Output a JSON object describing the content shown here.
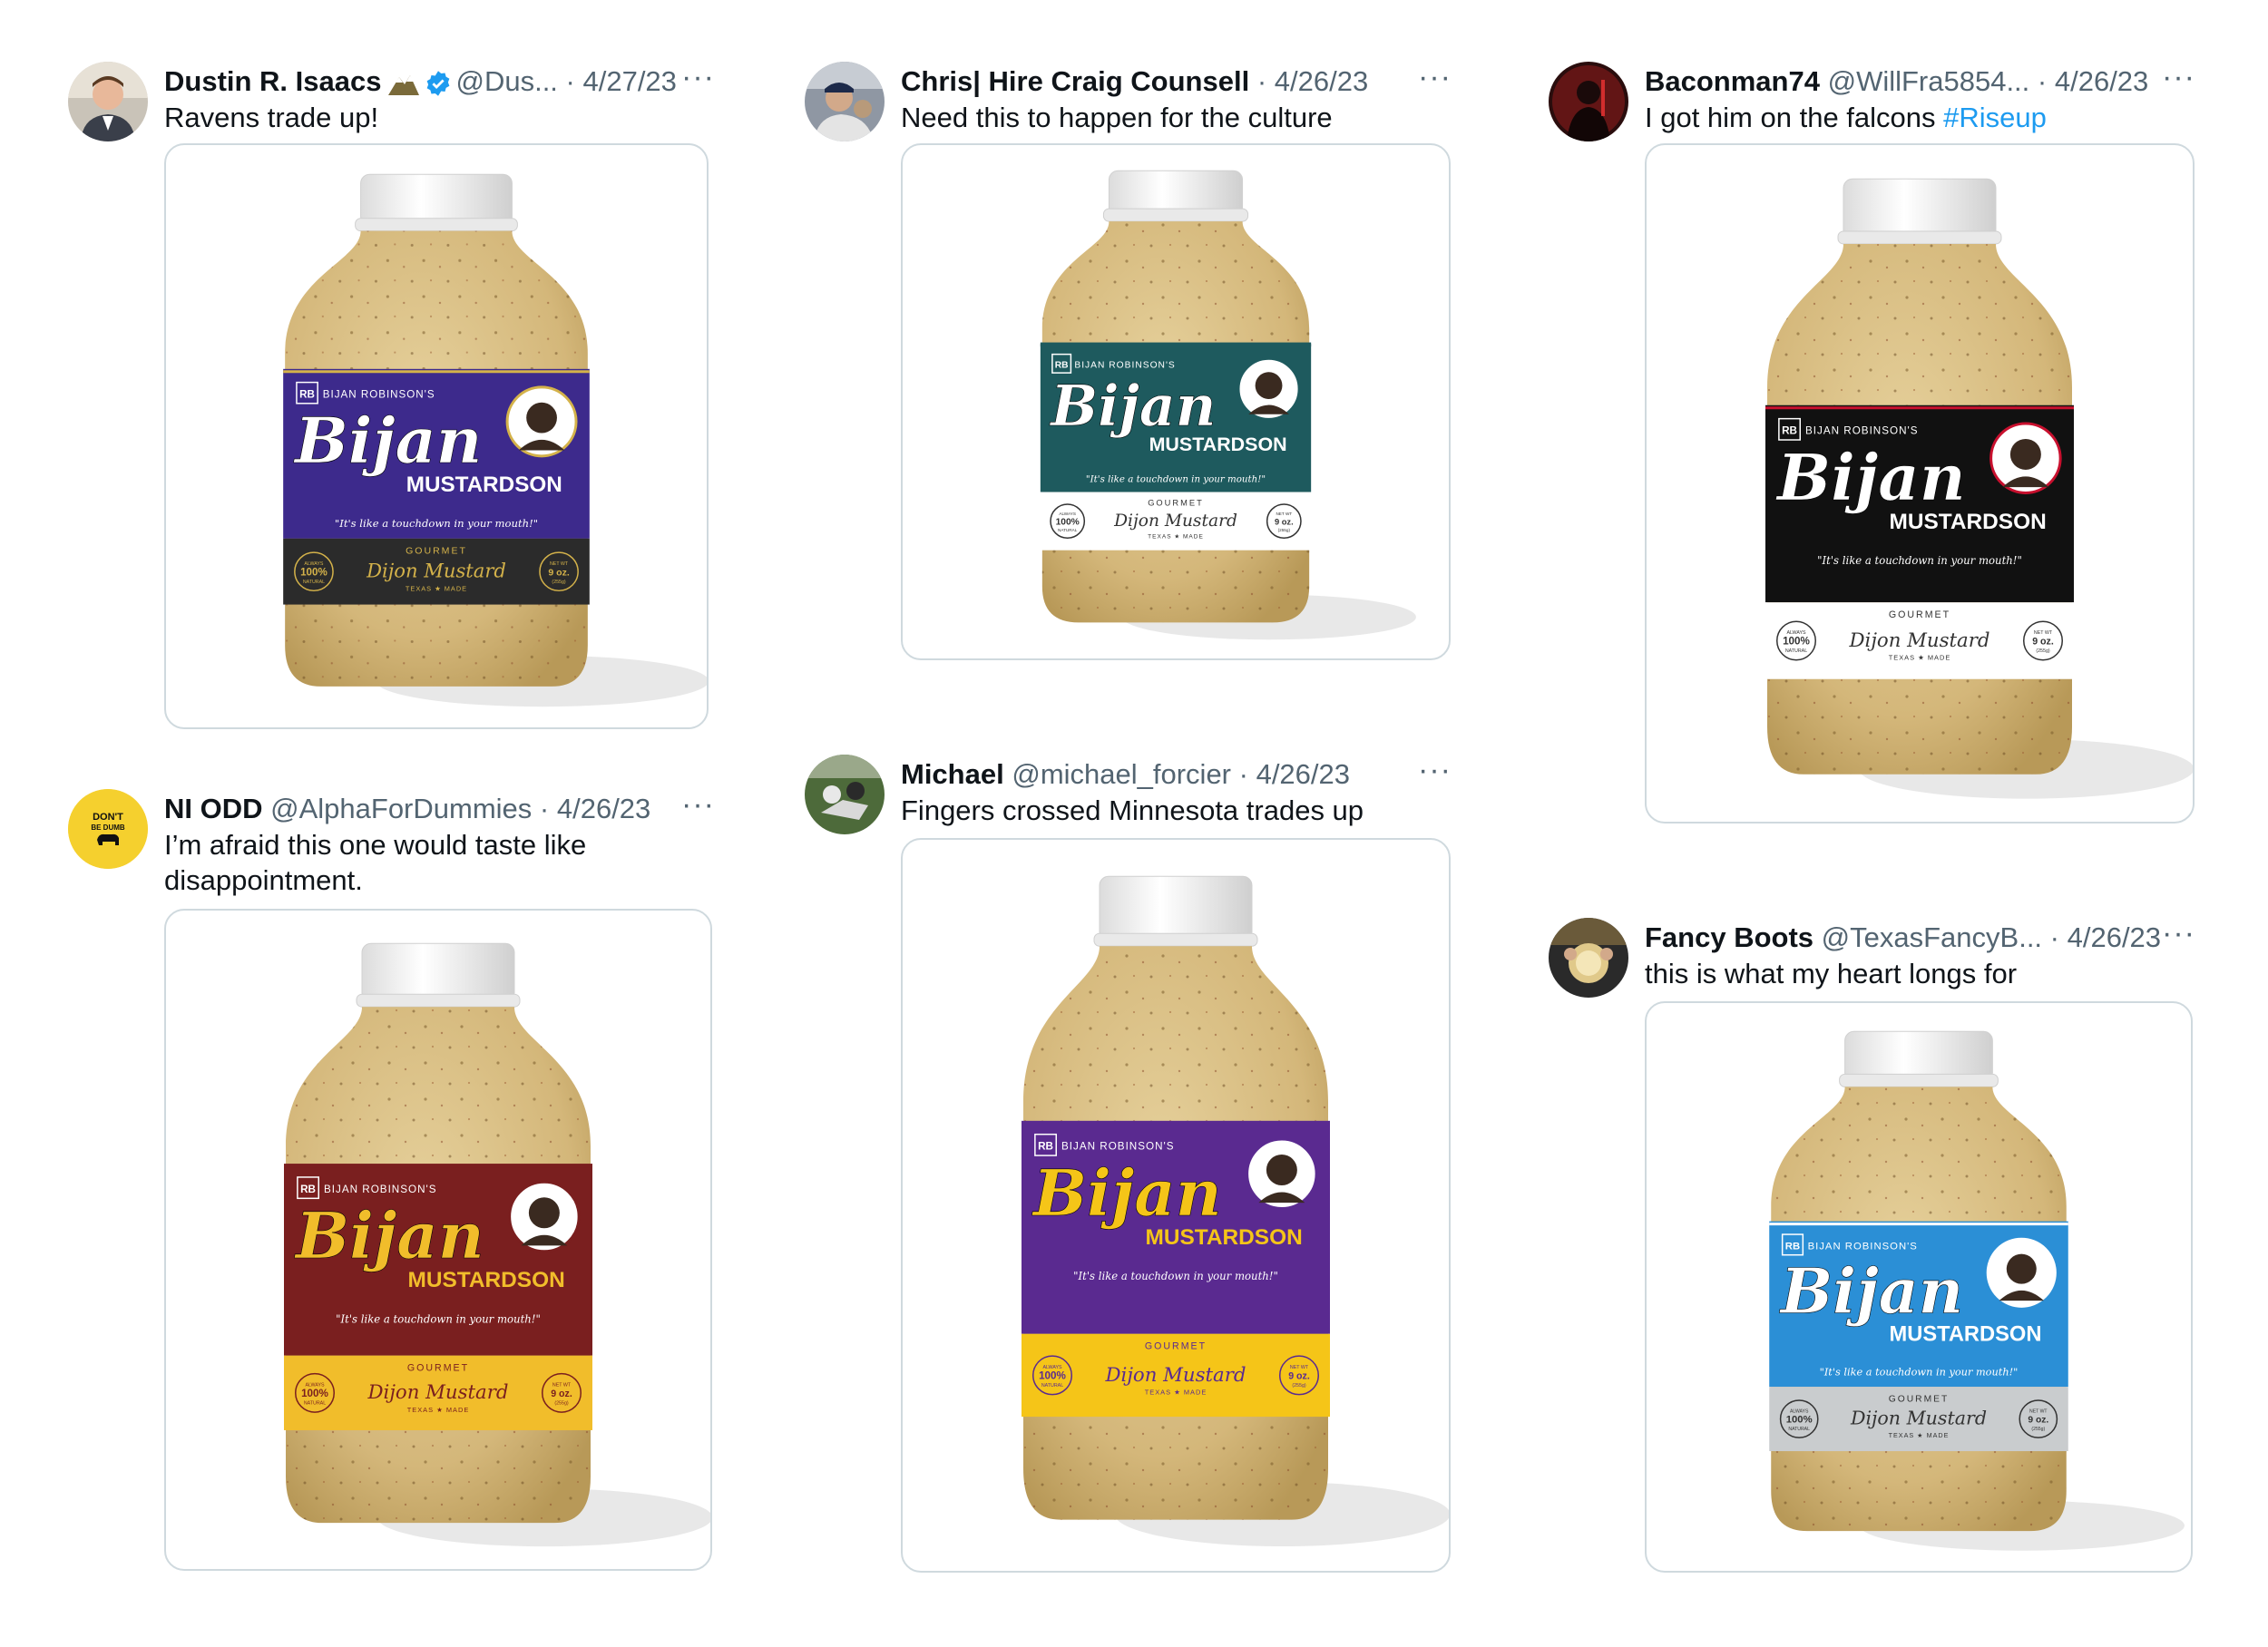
{
  "tweets": [
    {
      "name": "Dustin R. Isaacs",
      "handle": "@Dus...",
      "date": "4/27/23",
      "text": "Ravens trade up!",
      "more": "···",
      "label_color": "#3d2a8c",
      "band_color": "#2b2b2b",
      "script_color": "#ffffff",
      "accent_color": "#d4b24a"
    },
    {
      "name": "Chris| Hire Craig Counsell",
      "handle": "",
      "date": "4/26/23",
      "text": "Need this to happen for the culture",
      "more": "···",
      "label_color": "#1e5a5e",
      "band_color": "#ffffff",
      "script_color": "#ffffff",
      "accent_color": "#1e5a5e"
    },
    {
      "name": "Baconman74",
      "handle": "@WillFra5854...",
      "date": "4/26/23",
      "text": "I got him on the falcons ",
      "hashtag": "#Riseup",
      "more": "···",
      "label_color": "#111111",
      "band_color": "#ffffff",
      "script_color": "#ffffff",
      "accent_color": "#c8102e"
    },
    {
      "name": "NI ODD",
      "handle": "@AlphaForDummies",
      "date": "4/26/23",
      "text_line1": "I’m afraid this one would taste like",
      "text_line2": "disappointment.",
      "avatar_text1": "DON'T",
      "avatar_text2": "BE DUMB",
      "more": "···",
      "label_color": "#7a1f1f",
      "band_color": "#f1bd2b",
      "script_color": "#f1bd2b",
      "accent_color": "#7a1f1f"
    },
    {
      "name": "Michael",
      "handle": "@michael_forcier",
      "date": "4/26/23",
      "text": "Fingers crossed Minnesota trades up",
      "more": "···",
      "label_color": "#5a2a90",
      "band_color": "#f5c518",
      "script_color": "#f5c518",
      "accent_color": "#5a2a90"
    },
    {
      "name": "Fancy Boots",
      "handle": "@TexasFancyB...",
      "date": "4/26/23",
      "text": "this is what my heart longs for",
      "more": "···",
      "label_color": "#2b8fd6",
      "band_color": "#c9ccce",
      "script_color": "#ffffff",
      "accent_color": "#ffffff"
    }
  ],
  "label": {
    "brand_small": "BIJAN ROBINSON'S",
    "brand_big": "Bijan",
    "product_word": "MUSTARDSON",
    "tagline": "\"It's like a touchdown in your mouth!\"",
    "gourmet": "GOURMET",
    "dijon": "Dijon Mustard",
    "texas_made": "TEXAS ★ MADE",
    "badge_top": "ALWAYS",
    "badge_mid": "100%",
    "badge_bottom": "NATURAL",
    "net_wt": "NET WT",
    "weight": "9 oz.",
    "grams": "(255g)",
    "rb_badge": "RB"
  },
  "colors": {
    "mustard_body": "#d8bf86",
    "cap": "#f3f3f3",
    "verified_blue": "#1d9bf0",
    "link_blue": "#1d9bf0"
  },
  "icons": {
    "verified": "verified-badge-icon",
    "more": "more-options-icon",
    "emoji": "mountain-emoji-icon"
  }
}
